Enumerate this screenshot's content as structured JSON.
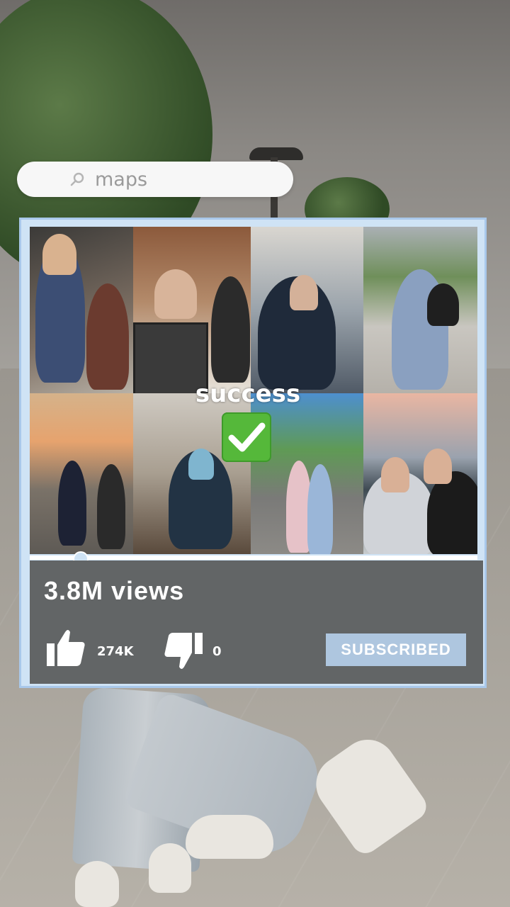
{
  "search": {
    "query": "maps"
  },
  "overlay": {
    "success_text": "success"
  },
  "video": {
    "views": "3.8M views",
    "likes": "274K",
    "dislikes": "0",
    "subscribe_label": "SUBSCRIBED",
    "progress": 0.11
  },
  "colors": {
    "frame": "#cfe3f5",
    "frame_border": "#a9c8ea",
    "panel": "#626566",
    "subscribe_bg": "#aec6df",
    "check_green": "#55b83a"
  },
  "icons": [
    "search-icon",
    "thumbs-up-icon",
    "thumbs-down-icon",
    "checkmark-icon"
  ]
}
